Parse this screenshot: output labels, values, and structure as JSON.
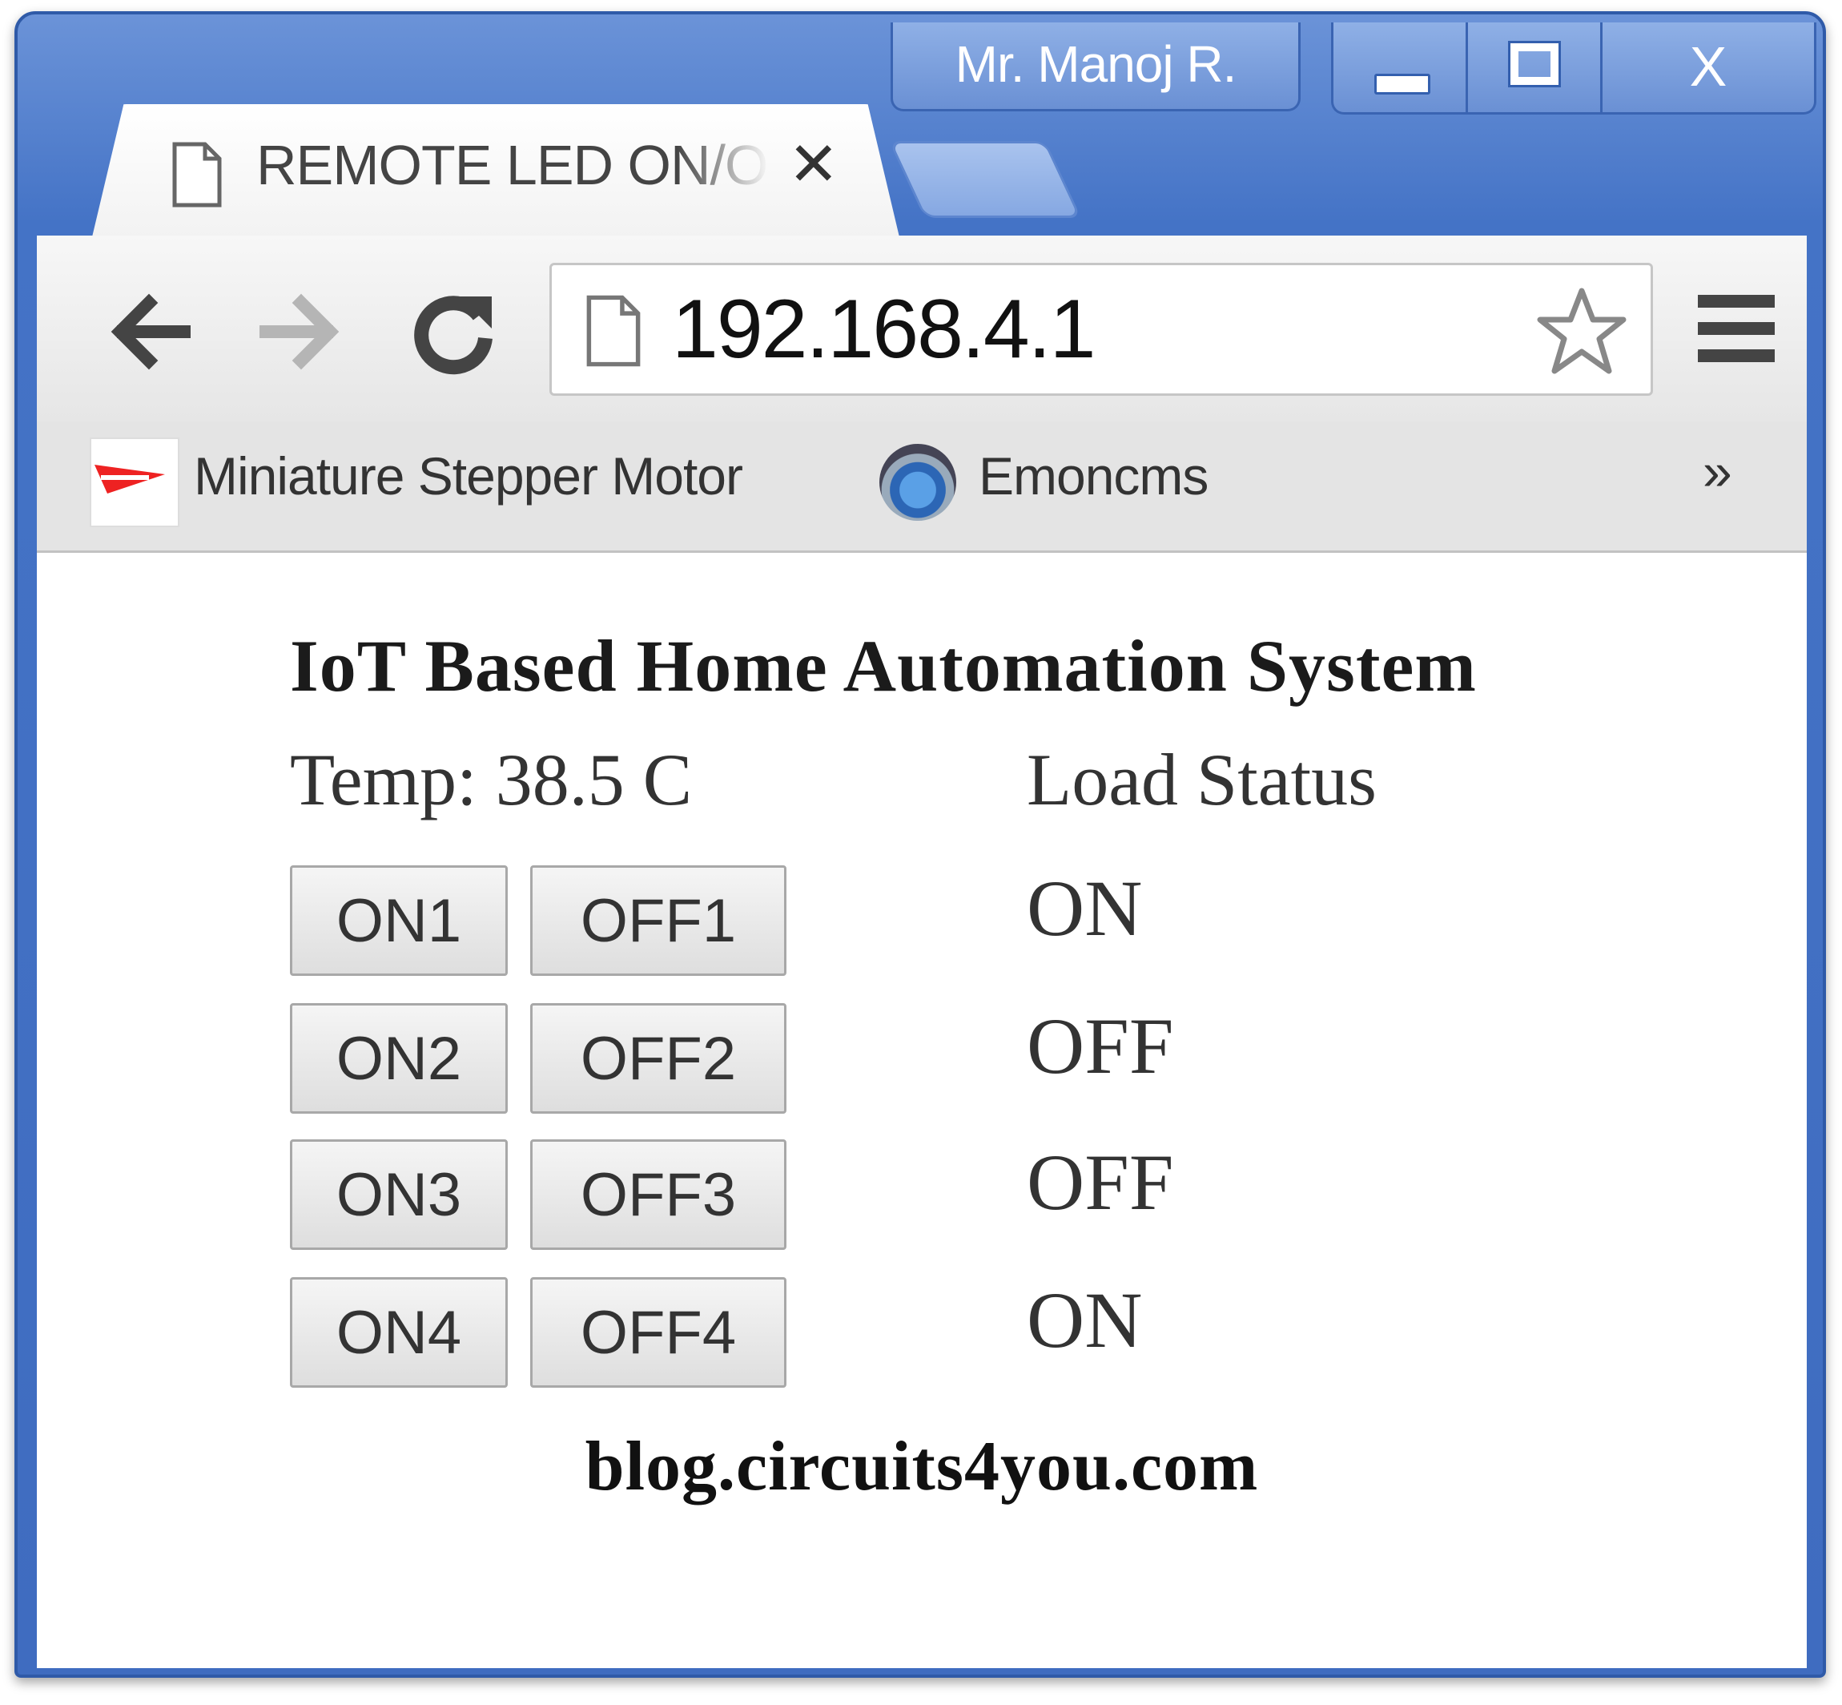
{
  "window": {
    "profile_name": "Mr. Manoj R.",
    "close_glyph": "X"
  },
  "tab": {
    "title": "REMOTE LED ON/OFF",
    "close_glyph": "✕"
  },
  "toolbar": {
    "url": "192.168.4.1"
  },
  "bookmarks": {
    "items": [
      {
        "label": "Miniature Stepper Motor",
        "icon": "site-favicon"
      },
      {
        "label": "Emoncms",
        "icon": "emoncms-favicon"
      }
    ],
    "more_glyph": "»"
  },
  "page": {
    "heading": "IoT Based Home Automation System",
    "temperature": "Temp: 38.5 C",
    "status_header": "Load Status",
    "loads": [
      {
        "on_label": "ON1",
        "off_label": "OFF1",
        "status": "ON"
      },
      {
        "on_label": "ON2",
        "off_label": "OFF2",
        "status": "OFF"
      },
      {
        "on_label": "ON3",
        "off_label": "OFF3",
        "status": "OFF"
      },
      {
        "on_label": "ON4",
        "off_label": "OFF4",
        "status": "ON"
      }
    ],
    "footer": "blog.circuits4you.com"
  },
  "colors": {
    "frame_blue": "#4473c6",
    "frame_border": "#2f5aa8",
    "button_border": "#a8a8a8"
  }
}
